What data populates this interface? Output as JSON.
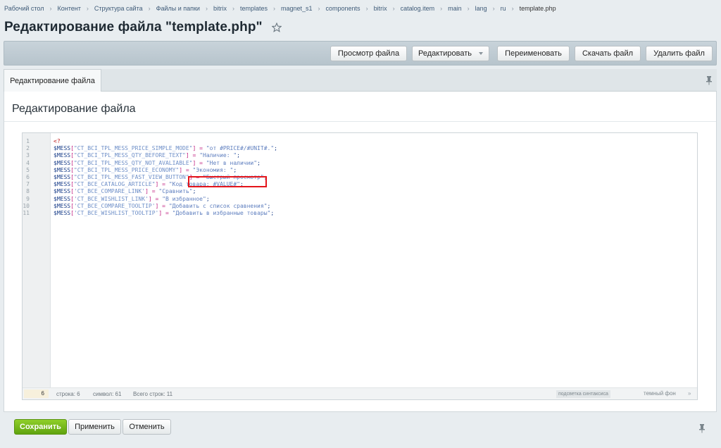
{
  "breadcrumb": [
    "Рабочий стол",
    "Контент",
    "Структура сайта",
    "Файлы и папки",
    "bitrix",
    "templates",
    "magnet_s1",
    "components",
    "bitrix",
    "catalog.item",
    "main",
    "lang",
    "ru",
    "template.php"
  ],
  "page_title": "Редактирование файла \"template.php\"",
  "toolbar": {
    "view_file": "Просмотр файла",
    "edit": "Редактировать",
    "rename": "Переименовать",
    "download": "Скачать файл",
    "delete": "Удалить файл"
  },
  "tab": {
    "label": "Редактирование файла"
  },
  "section_title": "Редактирование файла",
  "editor": {
    "line_numbers": [
      "1",
      "2",
      "3",
      "4",
      "5",
      "6",
      "7",
      "8",
      "9",
      "10",
      "11"
    ],
    "lines": [
      [
        [
          "tag",
          "<?"
        ]
      ],
      [
        [
          "var",
          "$MESS"
        ],
        [
          "op",
          "["
        ],
        [
          "key",
          "\"CT_BCI_TPL_MESS_PRICE_SIMPLE_MODE\""
        ],
        [
          "op",
          "]"
        ],
        [
          "var",
          " "
        ],
        [
          "op",
          "="
        ],
        [
          "var",
          " "
        ],
        [
          "str",
          "\"от #PRICE#/#UNIT#.\""
        ],
        [
          "var",
          ";"
        ]
      ],
      [
        [
          "var",
          "$MESS"
        ],
        [
          "op",
          "["
        ],
        [
          "key",
          "\"CT_BCI_TPL_MESS_QTY_BEFORE_TEXT\""
        ],
        [
          "op",
          "]"
        ],
        [
          "var",
          " "
        ],
        [
          "op",
          "="
        ],
        [
          "var",
          " "
        ],
        [
          "str",
          "\"Наличие: \""
        ],
        [
          "var",
          ";"
        ]
      ],
      [
        [
          "var",
          "$MESS"
        ],
        [
          "op",
          "["
        ],
        [
          "key",
          "\"CT_BCI_TPL_MESS_QTY_NOT_AVALIABLE\""
        ],
        [
          "op",
          "]"
        ],
        [
          "var",
          " "
        ],
        [
          "op",
          "="
        ],
        [
          "var",
          " "
        ],
        [
          "str",
          "\"Нет в наличии\""
        ],
        [
          "var",
          ";"
        ]
      ],
      [
        [
          "var",
          "$MESS"
        ],
        [
          "op",
          "["
        ],
        [
          "key",
          "\"CT_BCI_TPL_MESS_PRICE_ECONOMY\""
        ],
        [
          "op",
          "]"
        ],
        [
          "var",
          " "
        ],
        [
          "op",
          "="
        ],
        [
          "var",
          " "
        ],
        [
          "str",
          "\"Экономия: \""
        ],
        [
          "var",
          ";"
        ]
      ],
      [
        [
          "var",
          "$MESS"
        ],
        [
          "op",
          "["
        ],
        [
          "key",
          "\"CT_BCI_TPL_MESS_FAST_VIEW_BUTTON\""
        ],
        [
          "op",
          "]"
        ],
        [
          "var",
          " "
        ],
        [
          "op",
          "="
        ],
        [
          "var",
          " "
        ],
        [
          "str",
          "\"Быстрый просмотр\""
        ],
        [
          "var",
          ";"
        ]
      ],
      [
        [
          "var",
          "$MESS"
        ],
        [
          "op",
          "["
        ],
        [
          "key",
          "\"CT_BCE_CATALOG_ARTICLE\""
        ],
        [
          "op",
          "]"
        ],
        [
          "var",
          " "
        ],
        [
          "op",
          "="
        ],
        [
          "var",
          " "
        ],
        [
          "str",
          "\"Код товара: #VALUE#\""
        ],
        [
          "var",
          ";"
        ]
      ],
      [
        [
          "var",
          "$MESS"
        ],
        [
          "op",
          "["
        ],
        [
          "key",
          "'CT_BCE_COMPARE_LINK'"
        ],
        [
          "op",
          "]"
        ],
        [
          "var",
          " "
        ],
        [
          "op",
          "="
        ],
        [
          "var",
          " "
        ],
        [
          "str",
          "\"Сравнить\""
        ],
        [
          "var",
          ";"
        ]
      ],
      [
        [
          "var",
          "$MESS"
        ],
        [
          "op",
          "["
        ],
        [
          "key",
          "'CT_BCE_WISHLIST_LINK'"
        ],
        [
          "op",
          "]"
        ],
        [
          "var",
          " "
        ],
        [
          "op",
          "="
        ],
        [
          "var",
          " "
        ],
        [
          "str",
          "\"В избранное\""
        ],
        [
          "var",
          ";"
        ]
      ],
      [
        [
          "var",
          "$MESS"
        ],
        [
          "op",
          "["
        ],
        [
          "key",
          "'CT_BCE_COMPARE_TOOLTIP'"
        ],
        [
          "op",
          "]"
        ],
        [
          "var",
          " "
        ],
        [
          "op",
          "="
        ],
        [
          "var",
          " "
        ],
        [
          "str",
          "\"Добавить с список сравнения\""
        ],
        [
          "var",
          ";"
        ]
      ],
      [
        [
          "var",
          "$MESS"
        ],
        [
          "op",
          "["
        ],
        [
          "key",
          "'CT_BCE_WISHLIST_TOOLTIP'"
        ],
        [
          "op",
          "]"
        ],
        [
          "var",
          " "
        ],
        [
          "op",
          "="
        ],
        [
          "var",
          " "
        ],
        [
          "str",
          "\"Добавить в избранные товары\""
        ],
        [
          "var",
          ";"
        ]
      ]
    ],
    "status": {
      "current_line": "6",
      "line_label": "строка: 6",
      "symbol_label": "символ: 61",
      "total_label": "Всего строк: 11",
      "syntax_toggle": "подсветка синтаксиса",
      "dark_toggle": "темный фон",
      "arrows": "»"
    }
  },
  "buttons": {
    "save": "Сохранить",
    "apply": "Применить",
    "cancel": "Отменить"
  },
  "colors": {
    "accent_green": "#6db51b",
    "highlight_red": "#e4151b"
  }
}
